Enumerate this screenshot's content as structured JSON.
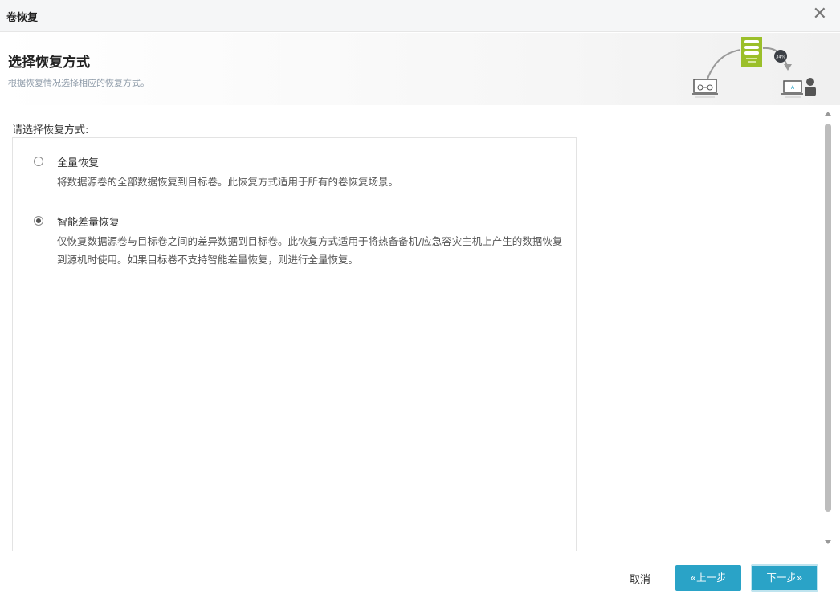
{
  "window": {
    "title": "卷恢复",
    "close_glyph": "✕"
  },
  "header": {
    "title": "选择恢复方式",
    "subtitle": "根据恢复情况选择相应的恢复方式。"
  },
  "section": {
    "label": "请选择恢复方式:"
  },
  "options": [
    {
      "title": "全量恢复",
      "description": "将数据源卷的全部数据恢复到目标卷。此恢复方式适用于所有的卷恢复场景。",
      "selected": false
    },
    {
      "title": "智能差量恢复",
      "description": "仅恢复数据源卷与目标卷之间的差异数据到目标卷。此恢复方式适用于将热备备机/应急容灾主机上产生的数据恢复到源机时使用。如果目标卷不支持智能差量恢复，则进行全量恢复。",
      "selected": true
    }
  ],
  "footer": {
    "cancel_label": "取消",
    "prev_label": "«上一步",
    "next_label": "下一步»"
  },
  "illustration": {
    "progress_badge": "34%",
    "screen_letter": "A"
  },
  "colors": {
    "accent": "#2aa3c7",
    "server_green": "#9bbf2a",
    "badge_dark": "#3b3f45"
  }
}
